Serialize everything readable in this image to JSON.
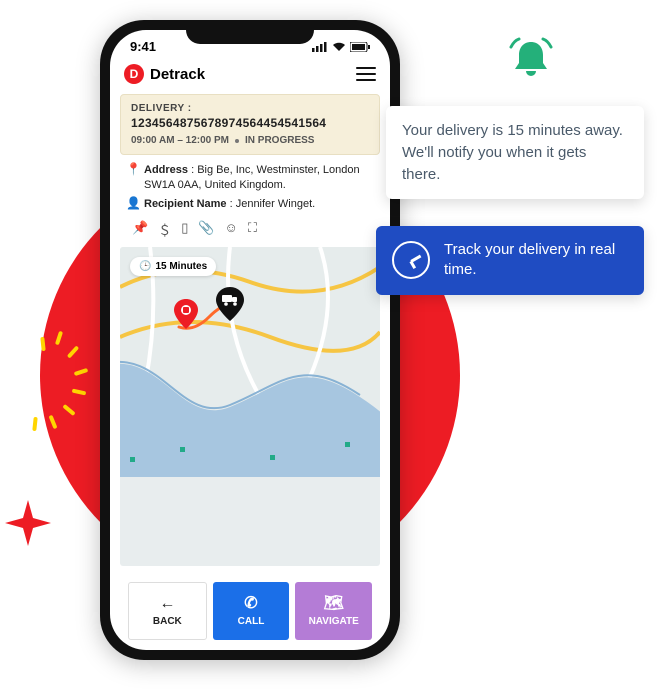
{
  "status_bar": {
    "time": "9:41"
  },
  "app": {
    "brand": "Detrack"
  },
  "delivery": {
    "label": "DELIVERY :",
    "id": "1234564875678974564454541564",
    "window": "09:00 AM – 12:00 PM",
    "status": "IN PROGRESS"
  },
  "info": {
    "address_key": "Address",
    "address_value": "Big Be, Inc, Westminster, London SW1A 0AA, United Kingdom.",
    "recipient_key": "Recipient Name",
    "recipient_value": "Jennifer Winget."
  },
  "map": {
    "eta": "15 Minutes"
  },
  "buttons": {
    "back": "BACK",
    "call": "CALL",
    "nav": "NAVIGATE"
  },
  "tips": {
    "white": "Your delivery is 15 minutes away. We'll notify you when it gets there.",
    "blue": "Track your delivery in real time."
  }
}
